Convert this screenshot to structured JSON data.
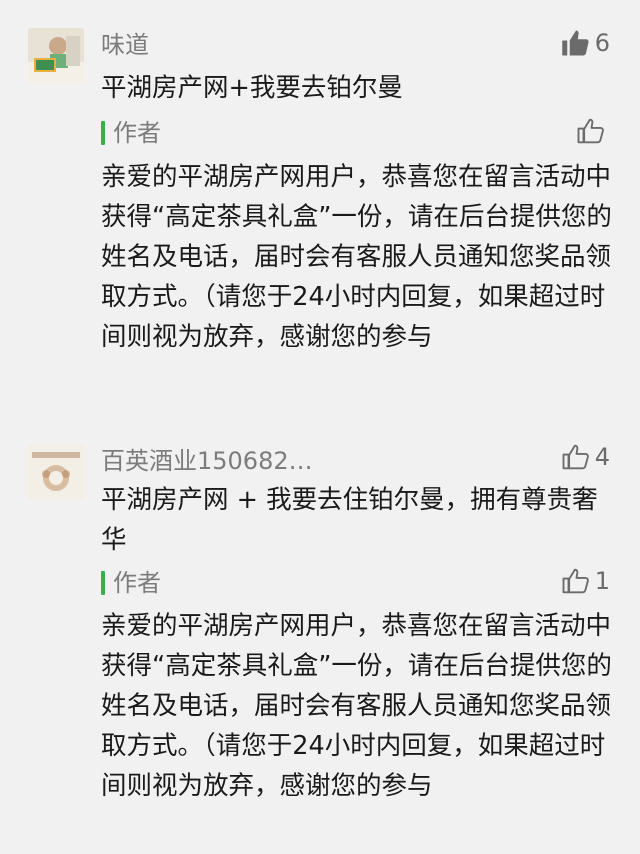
{
  "comments": [
    {
      "nickname": "味道",
      "like_count": "6",
      "text": "平湖房产网+我要去铂尔曼",
      "reply": {
        "author_label": "作者",
        "like_count": "",
        "text": "亲爱的平湖房产网用户，恭喜您在留言活动中获得“高定茶具礼盒”一份，请在后台提供您的姓名及电话，届时会有客服人员通知您奖品领取方式。（请您于24小时内回复，如果超过时间则视为放弃，感谢您的参与"
      }
    },
    {
      "nickname": "百英酒业150682…",
      "like_count": "4",
      "text": "平湖房产网 + 我要去住铂尔曼，拥有尊贵奢华",
      "reply": {
        "author_label": "作者",
        "like_count": "1",
        "text": "亲爱的平湖房产网用户，恭喜您在留言活动中获得“高定茶具礼盒”一份，请在后台提供您的姓名及电话，届时会有客服人员通知您奖品领取方式。（请您于24小时内回复，如果超过时间则视为放弃，感谢您的参与"
      }
    }
  ],
  "colors": {
    "background": "#f1f1f1",
    "author_bar": "#36b04a",
    "muted_text": "#7c7c7c",
    "body_text": "#1a1a1a",
    "liked_icon": "#6b6b6b"
  },
  "icons": {
    "liked": "thumbs-up-filled-icon",
    "not_liked": "thumbs-up-outline-icon"
  }
}
